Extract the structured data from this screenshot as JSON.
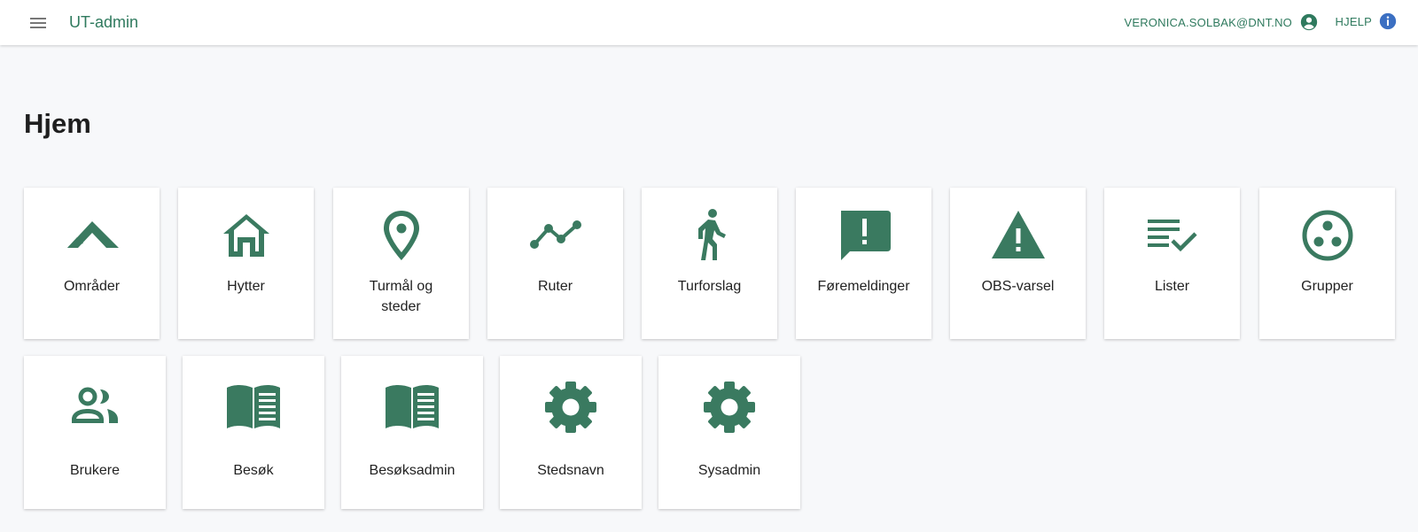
{
  "header": {
    "app_title": "UT-admin",
    "user_email": "VERONICA.SOLBAK@DNT.NO",
    "help_label": "HJELP"
  },
  "page": {
    "title": "Hjem"
  },
  "colors": {
    "accent": "#2f7a5e",
    "icon": "#3a7a60",
    "info": "#3b6fc2"
  },
  "tiles_row1": [
    {
      "label": "Områder",
      "icon": "terrain-icon"
    },
    {
      "label": "Hytter",
      "icon": "house-icon"
    },
    {
      "label": "Turmål og steder",
      "icon": "location-pin-icon"
    },
    {
      "label": "Ruter",
      "icon": "route-icon"
    },
    {
      "label": "Turforslag",
      "icon": "hiker-icon"
    },
    {
      "label": "Føremeldinger",
      "icon": "feedback-icon"
    },
    {
      "label": "OBS-varsel",
      "icon": "warning-icon"
    },
    {
      "label": "Lister",
      "icon": "playlist-check-icon"
    },
    {
      "label": "Grupper",
      "icon": "workspaces-icon"
    }
  ],
  "tiles_row2": [
    {
      "label": "Brukere",
      "icon": "users-icon"
    },
    {
      "label": "Besøk",
      "icon": "book-icon"
    },
    {
      "label": "Besøksadmin",
      "icon": "book-icon"
    },
    {
      "label": "Stedsnavn",
      "icon": "gear-icon"
    },
    {
      "label": "Sysadmin",
      "icon": "gear-icon"
    }
  ]
}
